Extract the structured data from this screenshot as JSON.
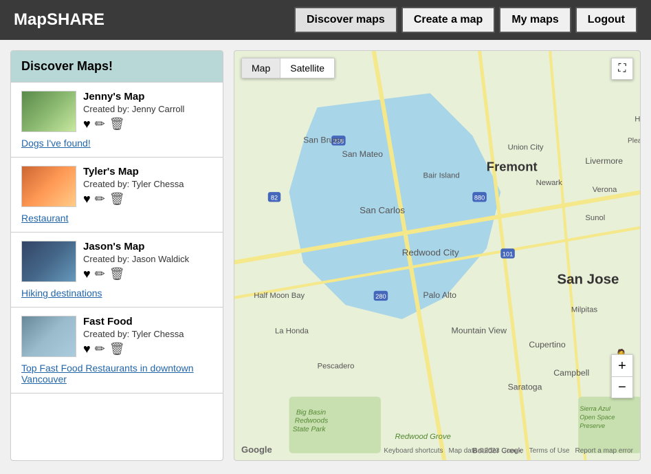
{
  "app": {
    "logo": "MapSHARE",
    "nav": [
      {
        "label": "Discover maps",
        "active": true,
        "name": "nav-discover"
      },
      {
        "label": "Create a map",
        "active": false,
        "name": "nav-create"
      },
      {
        "label": "My maps",
        "active": false,
        "name": "nav-my-maps"
      },
      {
        "label": "Logout",
        "active": false,
        "name": "nav-logout"
      }
    ]
  },
  "sidebar": {
    "title": "Discover Maps!",
    "maps": [
      {
        "id": "jennys-map",
        "name": "Jenny's Map",
        "creator": "Created by: Jenny Carroll",
        "description": "Dogs I've found!",
        "thumb_class": "thumb-1"
      },
      {
        "id": "tylers-map",
        "name": "Tyler's Map",
        "creator": "Created by: Tyler Chessa",
        "description": "Restaurant",
        "thumb_class": "thumb-2"
      },
      {
        "id": "jasons-map",
        "name": "Jason's Map",
        "creator": "Created by: Jason Waldick",
        "description": "Hiking destinations",
        "thumb_class": "thumb-3"
      },
      {
        "id": "fastfood-map",
        "name": "Fast Food",
        "creator": "Created by: Tyler Chessa",
        "description": "Top Fast Food Restaurants in downtown Vancouver",
        "thumb_class": "thumb-4"
      }
    ]
  },
  "map": {
    "type_labels": [
      "Map",
      "Satellite"
    ],
    "active_type": "Map",
    "fullscreen_icon": "⛶",
    "zoom_in": "+",
    "zoom_out": "−",
    "pegman": "🧍",
    "google_logo": "Google",
    "footer": [
      "Keyboard shortcuts",
      "Map data ©2023 Google",
      "Terms of Use",
      "Report a map error"
    ]
  }
}
